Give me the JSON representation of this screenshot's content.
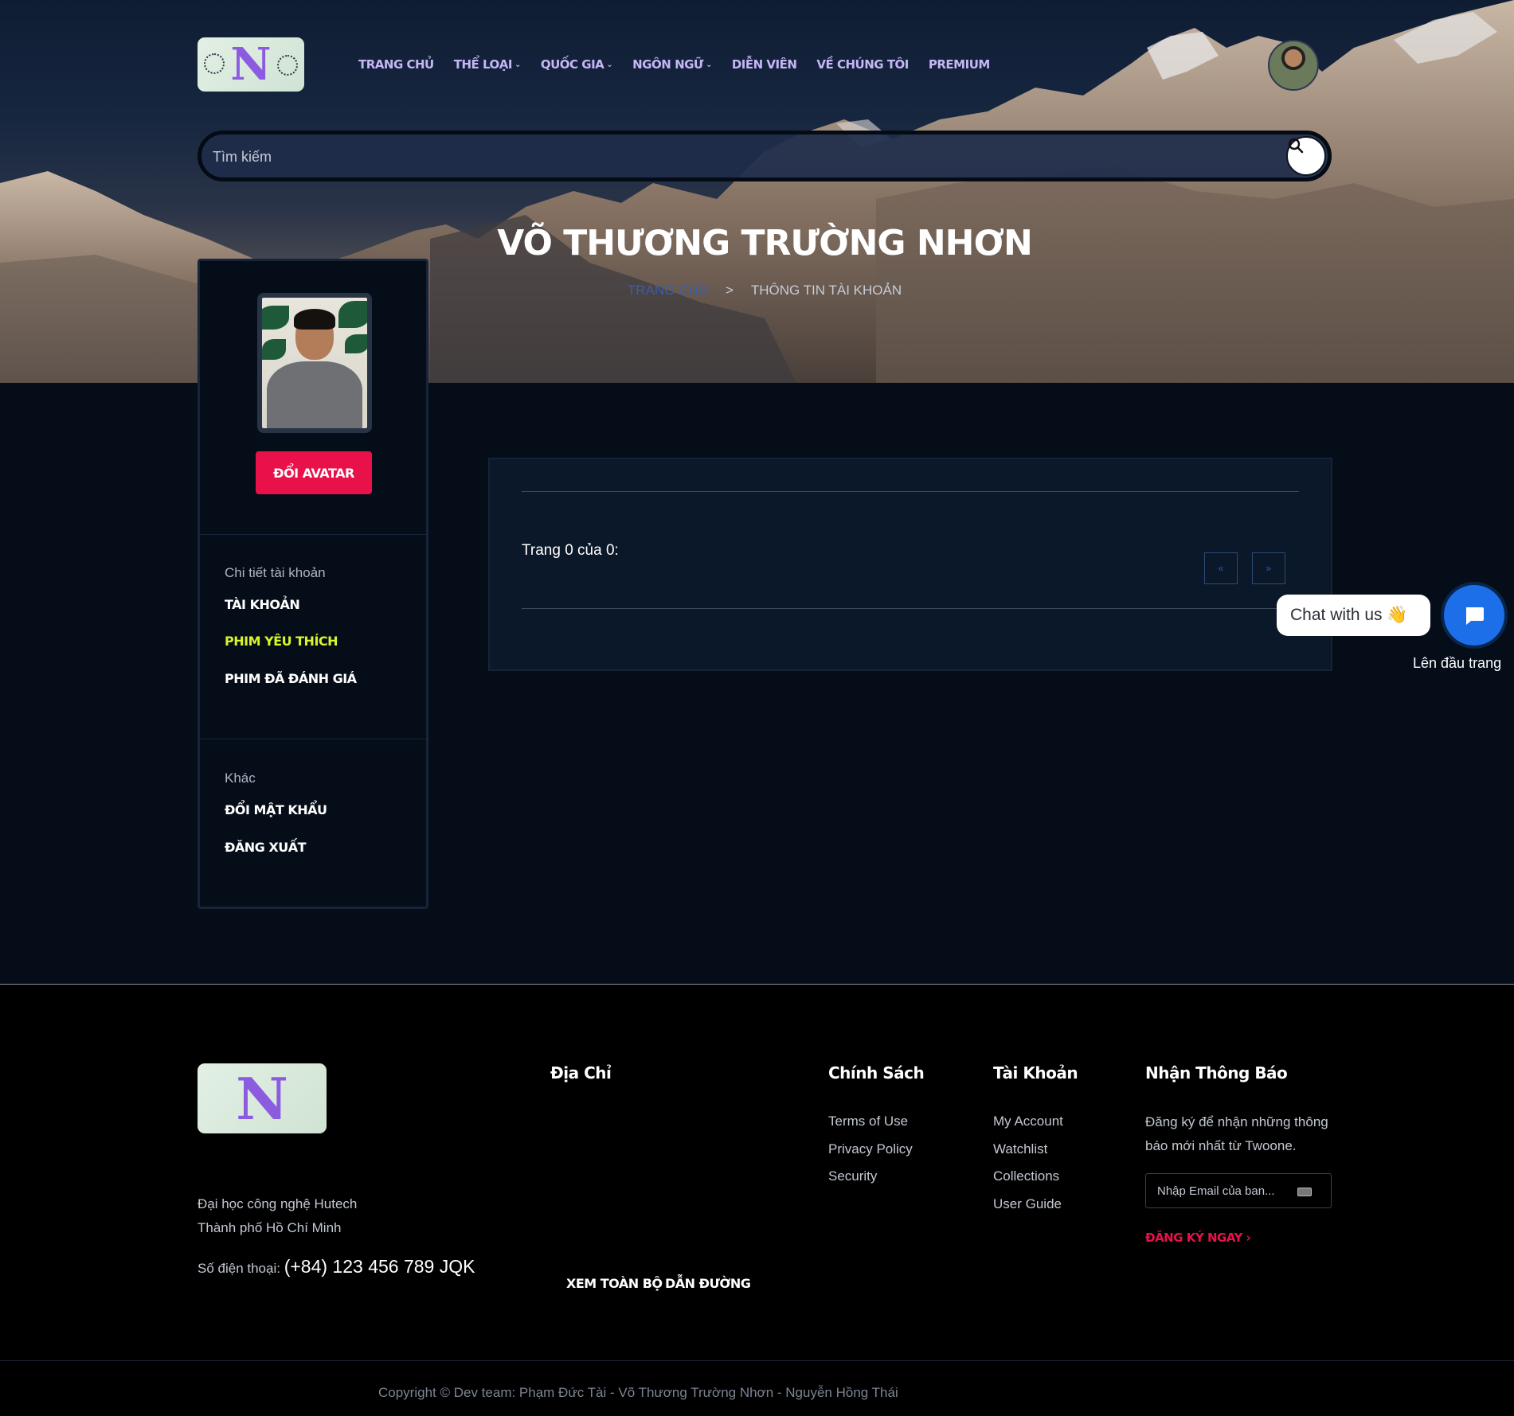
{
  "header": {
    "logo_letter": "N",
    "nav": [
      {
        "label": "TRANG CHỦ",
        "dropdown": false
      },
      {
        "label": "THỂ LOẠI",
        "dropdown": true
      },
      {
        "label": "QUỐC GIA",
        "dropdown": true
      },
      {
        "label": "NGÔN NGỮ",
        "dropdown": true
      },
      {
        "label": "DIỄN VIÊN",
        "dropdown": false
      },
      {
        "label": "VỀ CHÚNG TÔI",
        "dropdown": false
      },
      {
        "label": "PREMIUM",
        "dropdown": false
      }
    ],
    "search_placeholder": "Tìm kiếm"
  },
  "hero": {
    "title": "VÕ THƯƠNG TRƯỜNG NHƠN",
    "breadcrumb_home": "TRANG CHỦ",
    "breadcrumb_separator": ">",
    "breadcrumb_current": "THÔNG TIN TÀI KHOẢN"
  },
  "sidebar": {
    "change_avatar": "ĐỔI AVATAR",
    "section_account": "Chi tiết tài khoản",
    "links_account": [
      "TÀI KHOẢN",
      "PHIM YÊU THÍCH",
      "PHIM ĐÃ ĐÁNH GIÁ"
    ],
    "active_link": "PHIM YÊU THÍCH",
    "section_other": "Khác",
    "links_other": [
      "ĐỔI MẬT KHẨU",
      "ĐĂNG XUẤT"
    ]
  },
  "content": {
    "page_info": "Trang 0 của 0:",
    "prev": "«",
    "next": "»"
  },
  "chat": {
    "label": "Chat with us",
    "emoji": "👋",
    "to_top": "Lên đầu trang"
  },
  "footer": {
    "logo_letter": "N",
    "address_line1": "Đại học công nghệ Hutech",
    "address_line2": "Thành phố Hồ Chí Minh",
    "phone_label": "Số điện thoại:",
    "phone_value": "(+84) 123 456 789 JQK",
    "col_address": "Địa Chỉ",
    "view_all": "XEM TOÀN BỘ",
    "directions": "DẪN ĐƯỜNG",
    "col_policy": "Chính Sách",
    "policy_links": [
      "Terms of Use",
      "Privacy Policy",
      "Security"
    ],
    "col_account": "Tài Khoản",
    "account_links": [
      "My Account",
      "Watchlist",
      "Collections",
      "User Guide"
    ],
    "col_newsletter": "Nhận Thông Báo",
    "newsletter_text_1": "Đăng ký để nhận những thông",
    "newsletter_text_2": "báo mới nhất từ Twoone.",
    "email_placeholder": "Nhập Email của ban...",
    "subscribe": "ĐĂNG KÝ NGAY",
    "copyright": "Copyright © Dev team: Phạm Đức Tài - Võ Thương Trường Nhơn - Nguyễn Hồng Thái"
  },
  "colors": {
    "accent_red": "#e8114a",
    "active_yellow": "#d8f52c",
    "nav_purple": "#c6b6f5",
    "chat_blue": "#1c6fe8"
  }
}
